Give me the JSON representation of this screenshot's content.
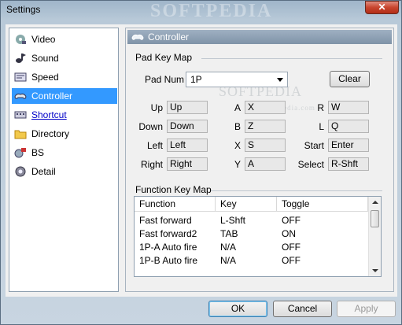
{
  "window": {
    "title": "Settings",
    "watermark": "SOFTPEDIA"
  },
  "nav": {
    "items": [
      {
        "label": "Video",
        "icon": "video-icon"
      },
      {
        "label": "Sound",
        "icon": "sound-icon"
      },
      {
        "label": "Speed",
        "icon": "speed-icon"
      },
      {
        "label": "Controller",
        "icon": "controller-icon"
      },
      {
        "label": "Shortcut",
        "icon": "shortcut-icon"
      },
      {
        "label": "Directory",
        "icon": "folder-icon"
      },
      {
        "label": "BS",
        "icon": "bs-icon"
      },
      {
        "label": "Detail",
        "icon": "detail-icon"
      }
    ]
  },
  "panel": {
    "title": "Controller",
    "watermark": "SOFTPEDIA",
    "watermark_sub": "www.softpedia.com",
    "pad_key_map": {
      "title": "Pad Key Map",
      "pad_num_label": "Pad Num :",
      "pad_num_value": "1P",
      "clear_label": "Clear",
      "rows": [
        [
          {
            "label": "Up",
            "value": "Up"
          },
          {
            "label": "A",
            "value": "X"
          },
          {
            "label": "R",
            "value": "W"
          }
        ],
        [
          {
            "label": "Down",
            "value": "Down"
          },
          {
            "label": "B",
            "value": "Z"
          },
          {
            "label": "L",
            "value": "Q"
          }
        ],
        [
          {
            "label": "Left",
            "value": "Left"
          },
          {
            "label": "X",
            "value": "S"
          },
          {
            "label": "Start",
            "value": "Enter"
          }
        ],
        [
          {
            "label": "Right",
            "value": "Right"
          },
          {
            "label": "Y",
            "value": "A"
          },
          {
            "label": "Select",
            "value": "R-Shft"
          }
        ]
      ]
    },
    "function_key_map": {
      "title": "Function Key Map",
      "columns": [
        "Function",
        "Key",
        "Toggle"
      ],
      "rows": [
        [
          "Fast forward",
          "L-Shft",
          "OFF"
        ],
        [
          "Fast forward2",
          "TAB",
          "ON"
        ],
        [
          "1P-A Auto fire",
          "N/A",
          "OFF"
        ],
        [
          "1P-B Auto fire",
          "N/A",
          "OFF"
        ]
      ]
    }
  },
  "footer": {
    "ok_label": "OK",
    "cancel_label": "Cancel",
    "apply_label": "Apply"
  },
  "colors": {
    "selection": "#3399ff",
    "link": "#0000c8"
  }
}
